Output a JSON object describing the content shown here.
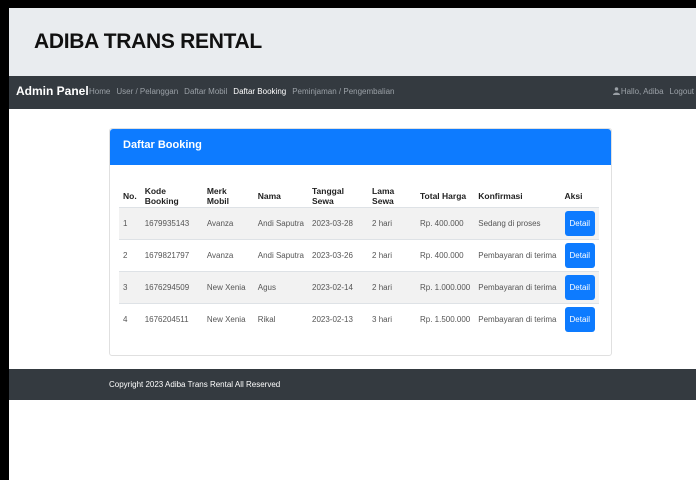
{
  "header": {
    "title": "ADIBA TRANS RENTAL"
  },
  "navbar": {
    "brand": "Admin Panel",
    "links": [
      "Home",
      "User / Pelanggan",
      "Daftar Mobil",
      "Daftar Booking",
      "Peminjaman / Pengembalian"
    ],
    "active_link": "Daftar Booking",
    "greeting": "Hallo, Adiba",
    "logout": "Logout"
  },
  "card": {
    "title": "Daftar Booking",
    "columns": [
      "No.",
      "Kode Booking",
      "Merk Mobil",
      "Nama",
      "Tanggal Sewa",
      "Lama Sewa",
      "Total Harga",
      "Konfirmasi",
      "Aksi"
    ],
    "rows": [
      {
        "no": "1",
        "kode": "1679935143",
        "merk": "Avanza",
        "nama": "Andi Saputra",
        "tanggal": "2023-03-28",
        "lama": "2 hari",
        "total": "Rp. 400.000",
        "konfirmasi": "Sedang di proses",
        "aksi": "Detail"
      },
      {
        "no": "2",
        "kode": "1679821797",
        "merk": "Avanza",
        "nama": "Andi Saputra",
        "tanggal": "2023-03-26",
        "lama": "2 hari",
        "total": "Rp. 400.000",
        "konfirmasi": "Pembayaran di terima",
        "aksi": "Detail"
      },
      {
        "no": "3",
        "kode": "1676294509",
        "merk": "New Xenia",
        "nama": "Agus",
        "tanggal": "2023-02-14",
        "lama": "2 hari",
        "total": "Rp. 1.000.000",
        "konfirmasi": "Pembayaran di terima",
        "aksi": "Detail"
      },
      {
        "no": "4",
        "kode": "1676204511",
        "merk": "New Xenia",
        "nama": "Rikal",
        "tanggal": "2023-02-13",
        "lama": "3 hari",
        "total": "Rp. 1.500.000",
        "konfirmasi": "Pembayaran di terima",
        "aksi": "Detail"
      }
    ]
  },
  "footer": {
    "text": "Copyright 2023 Adiba Trans Rental All Reserved"
  },
  "colors": {
    "primary": "#0d7bff",
    "navbar": "#343a40",
    "header_bg": "#e9ecef"
  },
  "icons": {
    "user": "user-icon"
  }
}
